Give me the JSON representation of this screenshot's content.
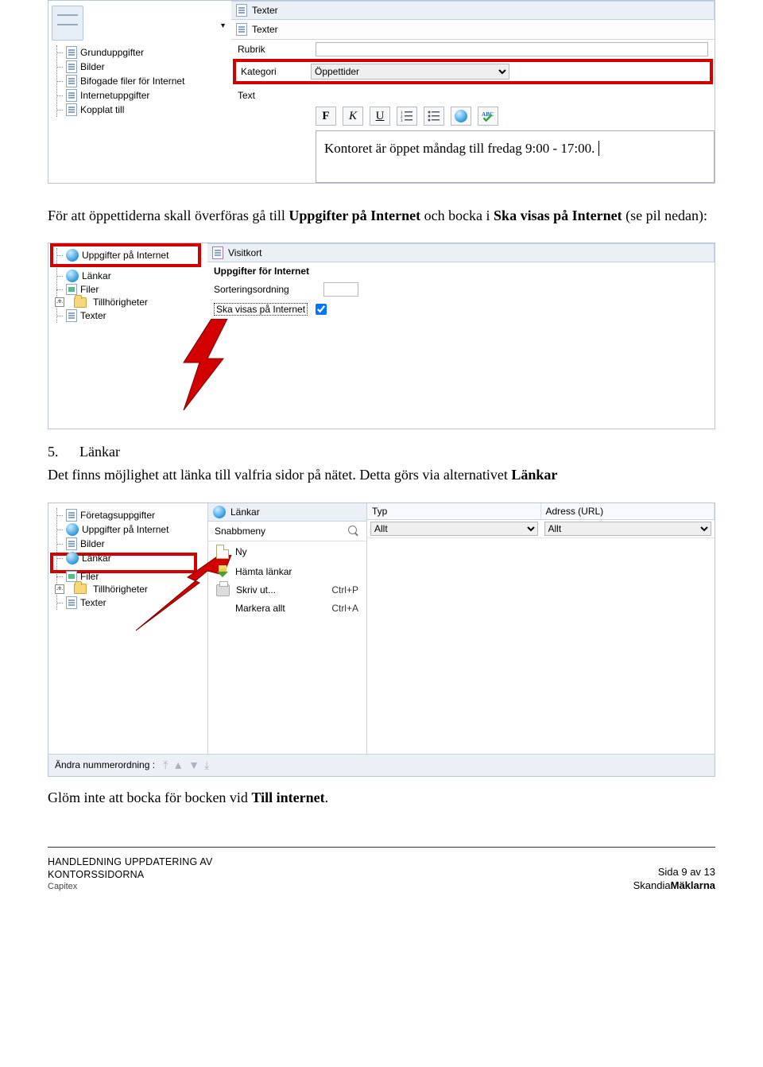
{
  "shot1": {
    "panel_title": "Texter",
    "sub_title": "Texter",
    "tree": [
      "Grunduppgifter",
      "Bilder",
      "Bifogade filer för Internet",
      "Internetuppgifter",
      "Kopplat till"
    ],
    "rubrik_label": "Rubrik",
    "kategori_label": "Kategori",
    "kategori_value": "Öppettider",
    "text_label": "Text",
    "editor_text": "Kontoret är öppet måndag till fredag 9:00 - 17:00.",
    "toolbar": {
      "bold": "F",
      "italic": "K",
      "underline": "U"
    }
  },
  "para1": {
    "pre": "För att öppettiderna skall överföras gå till ",
    "b1": "Uppgifter på Internet",
    "mid": " och bocka i ",
    "b2": "Ska visas på Internet",
    "post": " (se pil nedan):"
  },
  "shot2": {
    "panel_title": "Visitkort",
    "sect_title": "Uppgifter för Internet",
    "sort_label": "Sorteringsordning",
    "show_label": "Ska visas på Internet",
    "tree": [
      {
        "label": "Uppgifter på Internet",
        "icon": "globe",
        "red": true
      },
      {
        "label": "Länkar",
        "icon": "globe"
      },
      {
        "label": "Filer",
        "icon": "link"
      },
      {
        "label": "Tillhörigheter",
        "icon": "folder",
        "expand": true
      },
      {
        "label": "Texter",
        "icon": "sheet"
      }
    ]
  },
  "sec5": {
    "num": "5.",
    "title": "Länkar"
  },
  "para2": {
    "pre": "Det finns möjlighet att länka till valfria sidor på nätet. Detta görs via alternativet ",
    "b": "Länkar"
  },
  "shot3": {
    "panel_title": "Länkar",
    "snabb": "Snabbmeny",
    "menu": [
      {
        "label": "Ny",
        "icon": "newdoc",
        "shortcut": ""
      },
      {
        "label": "Hämta länkar",
        "icon": "dl",
        "shortcut": ""
      },
      {
        "label": "Skriv ut...",
        "icon": "print",
        "shortcut": "Ctrl+P"
      },
      {
        "label": "Markera allt",
        "icon": "none",
        "shortcut": "Ctrl+A"
      }
    ],
    "col_typ": "Typ",
    "col_adress": "Adress (URL)",
    "filter_all": "Allt",
    "footer_label": "Ändra nummerordning :",
    "tree": [
      {
        "label": "Företagsuppgifter",
        "icon": "sheet"
      },
      {
        "label": "Uppgifter på Internet",
        "icon": "globe"
      },
      {
        "label": "Bilder",
        "icon": "sheet"
      },
      {
        "label": "Länkar",
        "icon": "globe",
        "red": true
      },
      {
        "label": "Filer",
        "icon": "link"
      },
      {
        "label": "Tillhörigheter",
        "icon": "folder",
        "expand": true
      },
      {
        "label": "Texter",
        "icon": "sheet"
      }
    ]
  },
  "para3": {
    "pre": "Glöm inte att bocka för bocken vid ",
    "b": "Till internet",
    "post": "."
  },
  "footer": {
    "l1": "HANDLEDNING UPPDATERING AV",
    "l2": "KONTORSSIDORNA",
    "l3": "Capitex",
    "page": "Sida 9 av 13",
    "brand_a": "Skandia",
    "brand_b": "Mäklarna"
  }
}
